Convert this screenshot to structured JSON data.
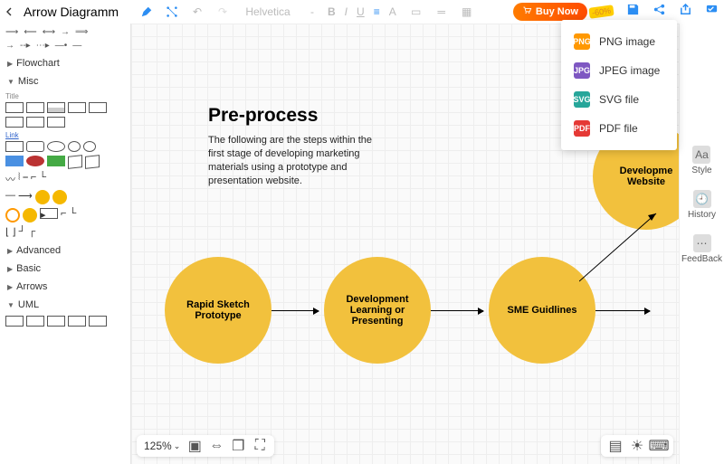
{
  "doc_title": "Arrow Diagramm",
  "toolbar": {
    "font_name": "Helvetica",
    "font_size": "-",
    "bold_label": "B",
    "italic_label": "I",
    "underline_label": "U",
    "buy_label": "Buy Now",
    "buy_badge": "-60%"
  },
  "sidebar": {
    "categories": [
      {
        "label": "Flowchart",
        "expanded": false
      },
      {
        "label": "Misc",
        "expanded": true
      },
      {
        "label": "Advanced",
        "expanded": false
      },
      {
        "label": "Basic",
        "expanded": false
      },
      {
        "label": "Arrows",
        "expanded": false
      },
      {
        "label": "UML",
        "expanded": true
      }
    ],
    "misc_title_label": "Title",
    "misc_link_label": "Link"
  },
  "rightpanel": {
    "items": [
      {
        "label": "Style"
      },
      {
        "label": "History"
      },
      {
        "label": "FeedBack"
      }
    ]
  },
  "canvas": {
    "heading": "Pre-process",
    "description": "The following are the steps within the first stage of developing marketing materials using a prototype and presentation website.",
    "nodes": [
      {
        "label": "Rapid Sketch Prototype"
      },
      {
        "label": "Development Learning or Presenting"
      },
      {
        "label": "SME Guidlines"
      },
      {
        "label": "Developme Website"
      }
    ]
  },
  "bottombar": {
    "zoom_label": "125%"
  },
  "export_menu": {
    "items": [
      {
        "label": "PNG image",
        "short": "PNG"
      },
      {
        "label": "JPEG image",
        "short": "JPG"
      },
      {
        "label": "SVG file",
        "short": "SVG"
      },
      {
        "label": "PDF file",
        "short": "PDF"
      }
    ]
  }
}
